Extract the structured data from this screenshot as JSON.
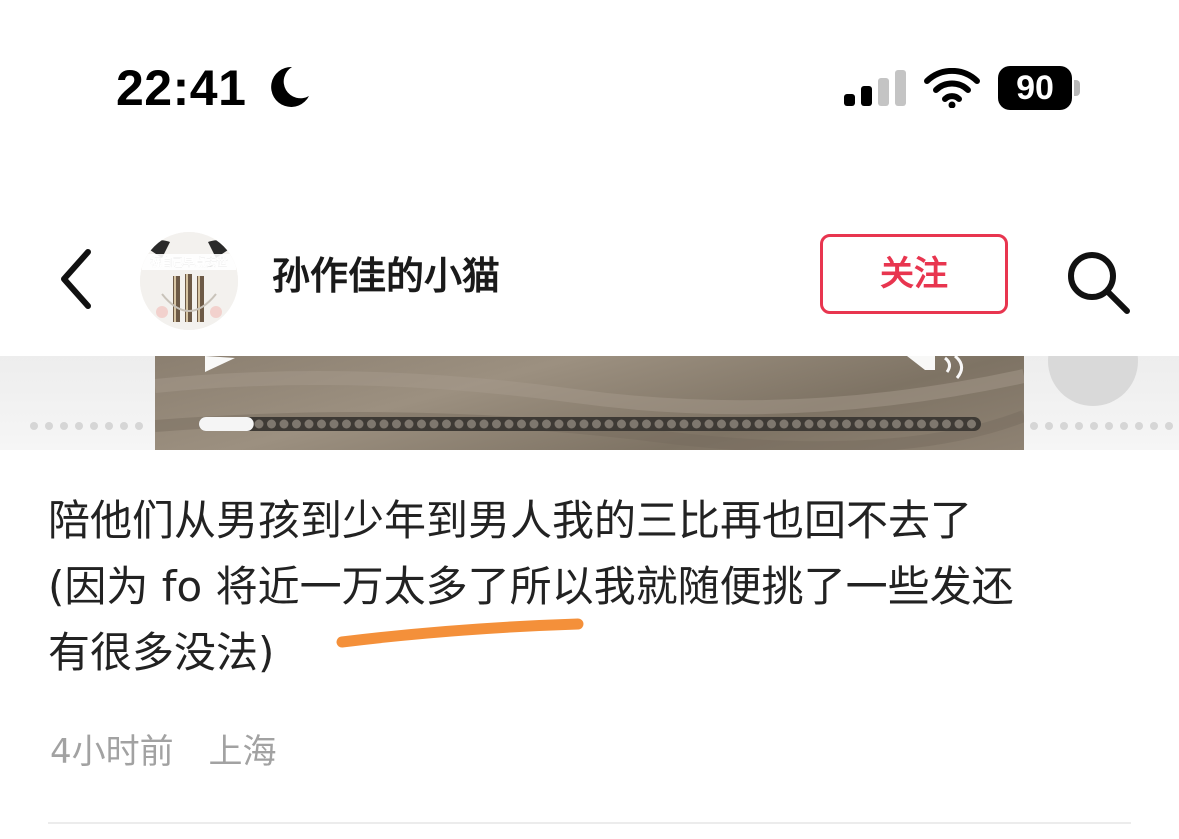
{
  "status_bar": {
    "time": "22:41",
    "battery_level": "90",
    "icons": [
      "moon-icon",
      "cellular-signal-icon",
      "wifi-icon",
      "battery-icon"
    ]
  },
  "header": {
    "back_icon": "chevron-left-icon",
    "avatar_caption": "祝自己早点去世",
    "username": "孙作佳的小猫",
    "follow_label": "关注",
    "search_icon": "search-icon"
  },
  "media": {
    "progress_fraction": 0.07,
    "icons": [
      "play-icon",
      "volume-icon"
    ]
  },
  "post": {
    "text": "陪他们从男孩到少年到男人我的三比再也回不去了\n(因为 fo 将近一万太多了所以我就随便挑了一些发还\n有很多没法)",
    "time_ago": "4小时前",
    "location": "上海"
  },
  "colors": {
    "accent": "#e8354f",
    "annotation": "#f4903a",
    "meta_text": "#a2a2a2"
  }
}
